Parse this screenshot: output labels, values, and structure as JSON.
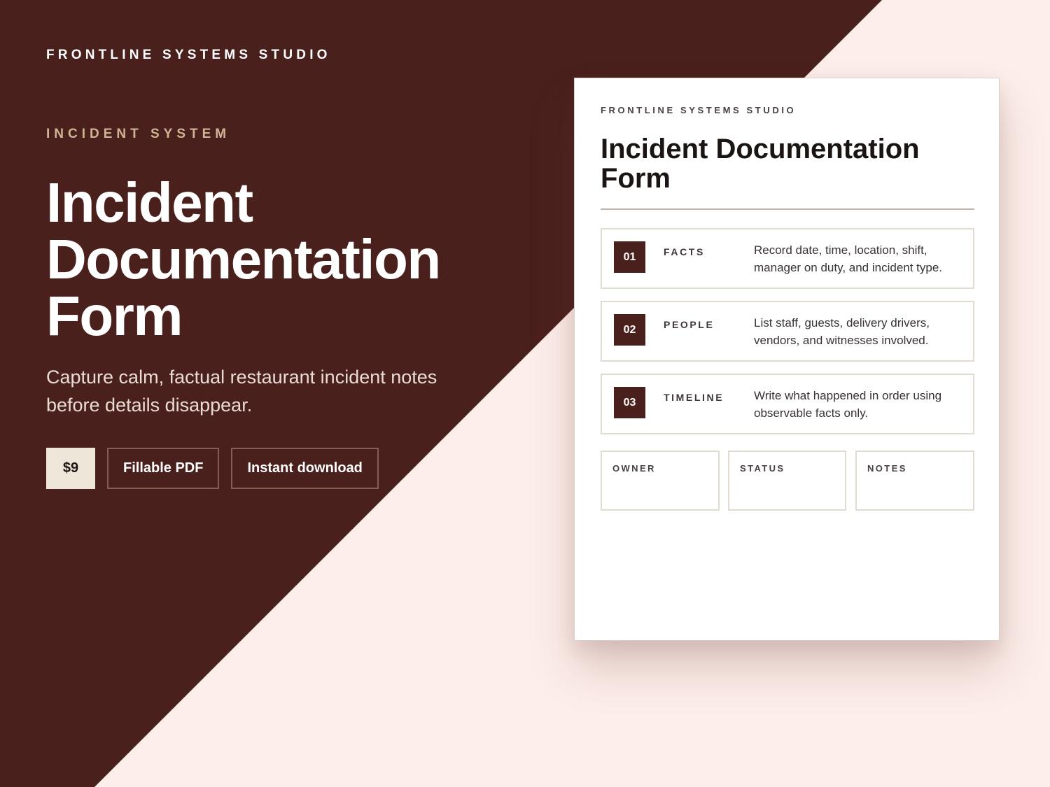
{
  "brand": "FRONTLINE SYSTEMS STUDIO",
  "hero": {
    "eyebrow": "INCIDENT SYSTEM",
    "title": "Incident Documentation Form",
    "subtitle": "Capture calm, factual restaurant incident notes before details disappear."
  },
  "pills": {
    "price": "$9",
    "format": "Fillable PDF",
    "delivery": "Instant download"
  },
  "document": {
    "brand": "FRONTLINE SYSTEMS STUDIO",
    "title": "Incident Documentation Form",
    "sections": [
      {
        "number": "01",
        "label": "FACTS",
        "text": "Record date, time, location, shift, manager on duty, and incident type."
      },
      {
        "number": "02",
        "label": "PEOPLE",
        "text": "List staff, guests, delivery drivers, vendors, and witnesses involved."
      },
      {
        "number": "03",
        "label": "TIMELINE",
        "text": "Write what happened in order using observable facts only."
      }
    ],
    "meta_fields": [
      "OWNER",
      "STATUS",
      "NOTES"
    ]
  },
  "colors": {
    "maroon": "#4a201d",
    "blush_background": "#fdeeea",
    "eyebrow_tan": "#cdb595",
    "price_chip": "#efe6da"
  }
}
